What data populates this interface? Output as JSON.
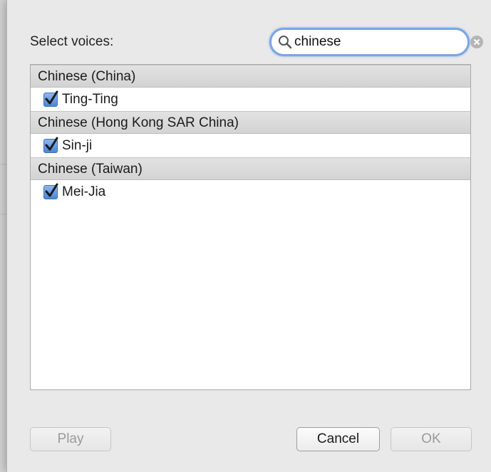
{
  "dialog": {
    "select_label": "Select voices:",
    "search": {
      "value": "chinese",
      "placeholder": ""
    }
  },
  "groups": [
    {
      "header": "Chinese (China)",
      "voices": [
        {
          "name": "Ting-Ting",
          "checked": true
        }
      ]
    },
    {
      "header": "Chinese (Hong Kong SAR China)",
      "voices": [
        {
          "name": "Sin-ji",
          "checked": true
        }
      ]
    },
    {
      "header": "Chinese (Taiwan)",
      "voices": [
        {
          "name": "Mei-Jia",
          "checked": true
        }
      ]
    }
  ],
  "buttons": {
    "play": "Play",
    "cancel": "Cancel",
    "ok": "OK"
  },
  "colors": {
    "accent": "#4b86d6",
    "focus_ring": "#7aa6e6",
    "group_header_bg": "#d9d9d9"
  }
}
